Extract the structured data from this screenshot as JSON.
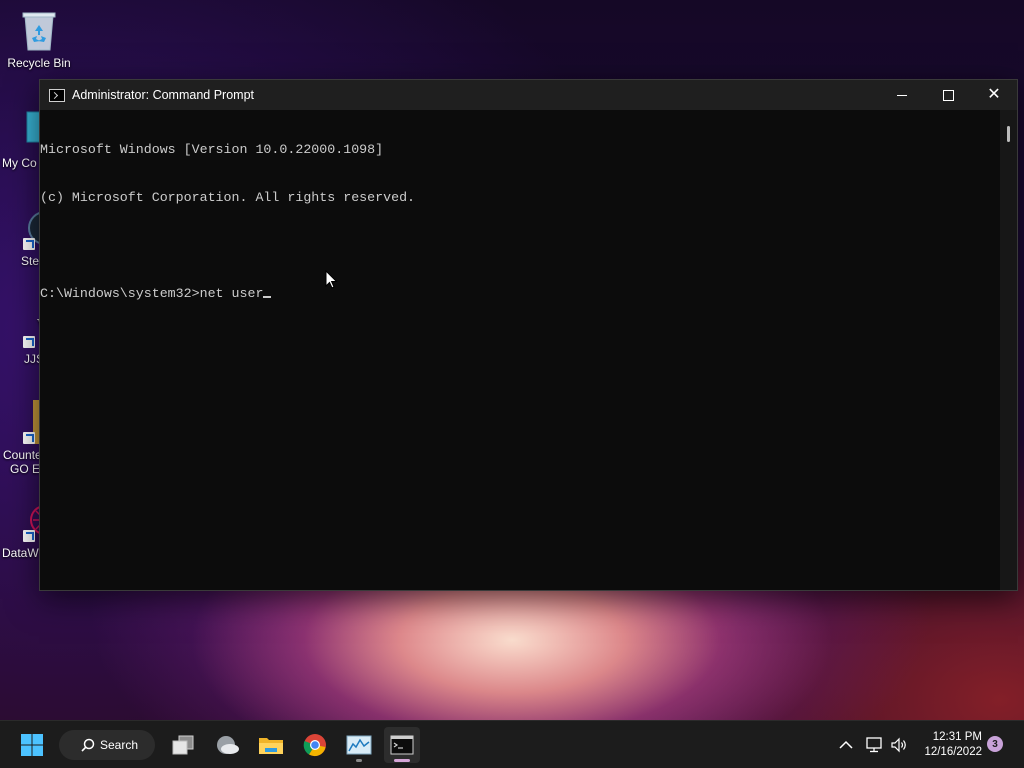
{
  "desktop": {
    "icons": [
      {
        "label": "Recycle Bin",
        "icon": "recycle-bin-icon"
      },
      {
        "label": "My Co",
        "icon": "computer-icon"
      },
      {
        "label": "Ste",
        "icon": "steam-icon"
      },
      {
        "label": "JJS",
        "icon": "jjs-app-icon"
      },
      {
        "label": "Counte",
        "label2": "GO E",
        "icon": "counter-strike-icon"
      },
      {
        "label": "DataW",
        "icon": "datawrapper-icon"
      }
    ]
  },
  "window": {
    "title": "Administrator: Command Prompt",
    "minimize_label": "–",
    "close_label": "✕",
    "console_lines": [
      "Microsoft Windows [Version 10.0.22000.1098]",
      "(c) Microsoft Corporation. All rights reserved.",
      "",
      "C:\\Windows\\system32>net user"
    ]
  },
  "taskbar": {
    "search_label": "Search",
    "apps": [
      {
        "name": "start-button",
        "icon": "windows-logo-icon"
      },
      {
        "name": "task-view-button",
        "icon": "task-view-icon"
      },
      {
        "name": "weather-widget",
        "icon": "weather-cloud-icon"
      },
      {
        "name": "file-explorer-button",
        "icon": "folder-icon"
      },
      {
        "name": "chrome-button",
        "icon": "chrome-icon"
      },
      {
        "name": "resource-monitor-button",
        "icon": "chart-window-icon"
      },
      {
        "name": "command-prompt-button",
        "icon": "terminal-icon"
      }
    ],
    "tray": {
      "time": "12:31 PM",
      "date": "12/16/2022",
      "notification_count": "3"
    }
  },
  "colors": {
    "console_text": "#cccccc",
    "console_bg": "#0c0c0c",
    "titlebar_bg": "#1f1f1f",
    "taskbar_bg": "#1c1c1c",
    "active_indicator": "#d6a6d8",
    "windows_blue": "#4cc2ff"
  }
}
